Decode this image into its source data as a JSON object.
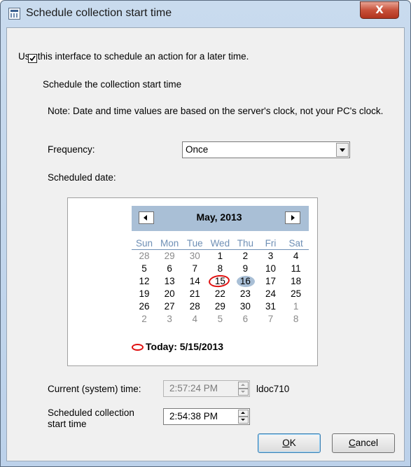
{
  "window": {
    "title": "Schedule collection start time",
    "close_label": "X"
  },
  "intro_text": "Use this interface to schedule an action for a later time.",
  "schedule_checkbox": {
    "label": "Schedule the collection start time",
    "checked": true
  },
  "note": "Note:  Date and time values are based on the server's clock, not your PC's clock.",
  "frequency": {
    "label": "Frequency:",
    "value": "Once"
  },
  "scheduled_date_label": "Scheduled date:",
  "calendar": {
    "month_label": "May, 2013",
    "weekdays": [
      "Sun",
      "Mon",
      "Tue",
      "Wed",
      "Thu",
      "Fri",
      "Sat"
    ],
    "weeks": [
      [
        "28",
        "29",
        "30",
        "1",
        "2",
        "3",
        "4"
      ],
      [
        "5",
        "6",
        "7",
        "8",
        "9",
        "10",
        "11"
      ],
      [
        "12",
        "13",
        "14",
        "15",
        "16",
        "17",
        "18"
      ],
      [
        "19",
        "20",
        "21",
        "22",
        "23",
        "24",
        "25"
      ],
      [
        "26",
        "27",
        "28",
        "29",
        "30",
        "31",
        "1"
      ],
      [
        "2",
        "3",
        "4",
        "5",
        "6",
        "7",
        "8"
      ]
    ],
    "today_text": "Today: 5/15/2013"
  },
  "current_time": {
    "label": "Current (system) time:",
    "value": "2:57:24 PM",
    "server": "ldoc710"
  },
  "scheduled_time": {
    "label_line1": "Scheduled collection",
    "label_line2": "start time",
    "value": "2:54:38 PM"
  },
  "buttons": {
    "ok_prefix": "",
    "ok_key": "O",
    "ok_rest": "K",
    "cancel_key": "C",
    "cancel_rest": "ancel"
  },
  "colors": {
    "calendar_header": "#a9bfd6",
    "weekday_text": "#6e8fb5",
    "today_mark": "#e01010"
  }
}
